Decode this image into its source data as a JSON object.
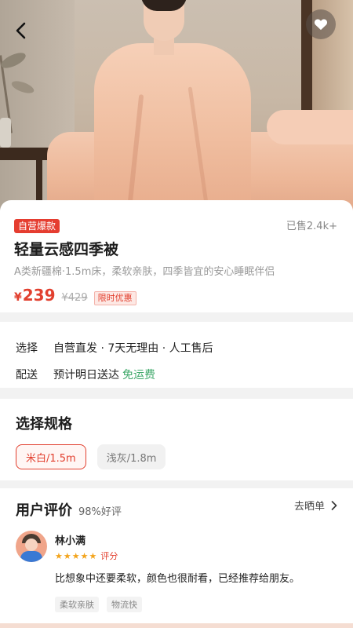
{
  "product": {
    "badge": "自营爆款",
    "sold": "已售2.4k+",
    "title": "轻量云感四季被",
    "subtitle": "A类新疆棉·1.5m床，柔软亲肤，四季皆宜的安心睡眠伴侣",
    "currency": "¥",
    "price": "239",
    "original_price": "¥429",
    "promo": "限时优惠"
  },
  "service": {
    "select_label": "选择",
    "select_value": "自营直发 · 7天无理由 · 人工售后",
    "delivery_label": "配送",
    "delivery_value": "预计明日送达",
    "free_shipping": "免运费"
  },
  "spec": {
    "title": "选择规格",
    "options": [
      {
        "label": "米白/1.5m",
        "selected": true
      },
      {
        "label": "浅灰/1.8m",
        "selected": false
      }
    ]
  },
  "reviews": {
    "title": "用户评价",
    "positive_rate": "98%好评",
    "write_link": "去晒单",
    "item": {
      "name": "林小满",
      "stars": 5,
      "score_label": "评分",
      "text": "比想象中还要柔软，颜色也很耐看，已经推荐给朋友。",
      "tags": [
        "柔软亲肤",
        "物流快"
      ]
    }
  },
  "icons": {
    "back": "back-arrow-icon",
    "favorite": "heart-icon",
    "chevron": "chevron-right-icon",
    "star": "star-icon"
  },
  "colors": {
    "accent": "#e2402f",
    "free_shipping": "#3fa86a",
    "star": "#f3a41c"
  }
}
